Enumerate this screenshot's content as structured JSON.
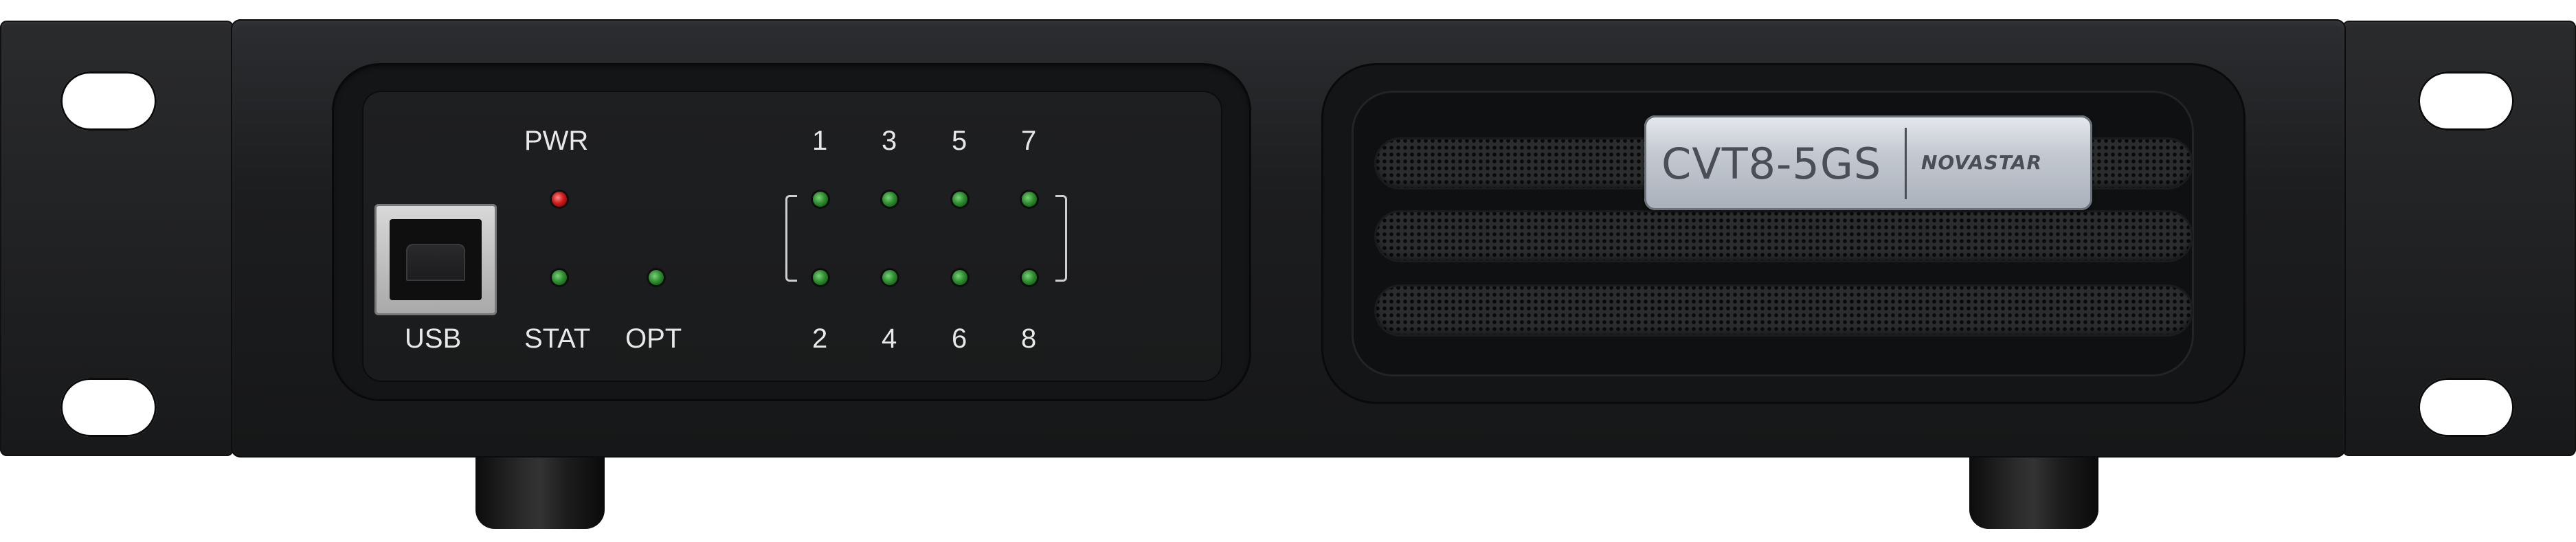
{
  "device": {
    "model": "CVT8-5GS",
    "brand": "NOVASTAR"
  },
  "usb": {
    "label": "USB"
  },
  "indicators": {
    "pwr": {
      "label": "PWR",
      "color": "#d01a1a"
    },
    "stat": {
      "label": "STAT",
      "color": "#2f8f30"
    },
    "opt": {
      "label": "OPT",
      "color": "#2f8f30"
    }
  },
  "ports": {
    "top_labels": [
      "1",
      "3",
      "5",
      "7"
    ],
    "bottom_labels": [
      "2",
      "4",
      "6",
      "8"
    ],
    "led_color": "#2f8f30"
  }
}
